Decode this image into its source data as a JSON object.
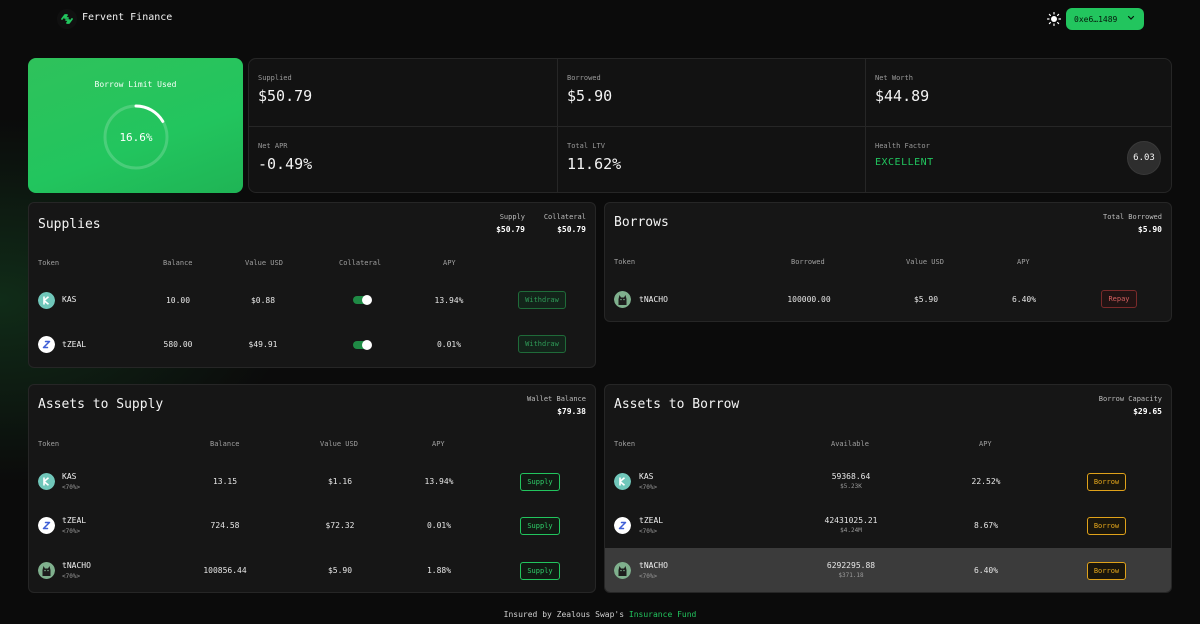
{
  "header": {
    "app_title": "Fervent Finance",
    "logo_icon": "fervent-logo-icon",
    "theme_icon": "sun-icon",
    "wallet_address": "0xe6…1489",
    "accent": "#22c55e"
  },
  "borrow_limit": {
    "title": "Borrow Limit Used",
    "value": "16.6%",
    "fraction": 0.166
  },
  "stats": {
    "supplied": {
      "label": "Supplied",
      "value": "$50.79"
    },
    "borrowed": {
      "label": "Borrowed",
      "value": "$5.90"
    },
    "net_worth": {
      "label": "Net Worth",
      "value": "$44.89"
    },
    "net_apr": {
      "label": "Net APR",
      "value": "-0.49%"
    },
    "total_ltv": {
      "label": "Total LTV",
      "value": "11.62%"
    },
    "health_factor": {
      "label": "Health Factor",
      "status": "EXCELLENT",
      "value": "6.03"
    }
  },
  "supplies": {
    "title": "Supplies",
    "summary": [
      {
        "label": "Supply",
        "value": "$50.79"
      },
      {
        "label": "Collateral",
        "value": "$50.79"
      }
    ],
    "columns": [
      "Token",
      "Balance",
      "Value USD",
      "Collateral",
      "APY"
    ],
    "rows": [
      {
        "token": "KAS",
        "icon": "kas-token-icon",
        "balance": "10.00",
        "value": "$0.88",
        "collateral": true,
        "apy": "13.94%",
        "action": "Withdraw"
      },
      {
        "token": "tZEAL",
        "icon": "tzeal-token-icon",
        "balance": "580.00",
        "value": "$49.91",
        "collateral": true,
        "apy": "0.01%",
        "action": "Withdraw"
      }
    ]
  },
  "borrows": {
    "title": "Borrows",
    "summary": {
      "label": "Total Borrowed",
      "value": "$5.90"
    },
    "columns": [
      "Token",
      "Borrowed",
      "Value USD",
      "APY"
    ],
    "rows": [
      {
        "token": "tNACHO",
        "icon": "tnacho-token-icon",
        "borrowed": "100000.00",
        "value": "$5.90",
        "apy": "6.40%",
        "action": "Repay"
      }
    ]
  },
  "assets_to_supply": {
    "title": "Assets to Supply",
    "summary": {
      "label": "Wallet Balance",
      "value": "$79.38"
    },
    "columns": [
      "Token",
      "Balance",
      "Value USD",
      "APY"
    ],
    "rows": [
      {
        "token": "KAS",
        "ltv": "<70%>",
        "icon": "kas-token-icon",
        "balance": "13.15",
        "value": "$1.16",
        "apy": "13.94%",
        "action": "Supply"
      },
      {
        "token": "tZEAL",
        "ltv": "<70%>",
        "icon": "tzeal-token-icon",
        "balance": "724.58",
        "value": "$72.32",
        "apy": "0.01%",
        "action": "Supply"
      },
      {
        "token": "tNACHO",
        "ltv": "<70%>",
        "icon": "tnacho-token-icon",
        "balance": "100856.44",
        "value": "$5.90",
        "apy": "1.88%",
        "action": "Supply"
      }
    ]
  },
  "assets_to_borrow": {
    "title": "Assets to Borrow",
    "summary": {
      "label": "Borrow Capacity",
      "value": "$29.65"
    },
    "columns": [
      "Token",
      "Available",
      "APY"
    ],
    "rows": [
      {
        "token": "KAS",
        "ltv": "<70%>",
        "icon": "kas-token-icon",
        "available": "59368.64",
        "available_usd": "$5.23K",
        "apy": "22.52%",
        "action": "Borrow"
      },
      {
        "token": "tZEAL",
        "ltv": "<70%>",
        "icon": "tzeal-token-icon",
        "available": "42431025.21",
        "available_usd": "$4.24M",
        "apy": "8.67%",
        "action": "Borrow"
      },
      {
        "token": "tNACHO",
        "ltv": "<70%>",
        "icon": "tnacho-token-icon",
        "available": "6292295.88",
        "available_usd": "$371.18",
        "apy": "6.40%",
        "action": "Borrow"
      }
    ]
  },
  "footer": {
    "text": "Insured by Zealous Swap's",
    "link": "Insurance Fund"
  }
}
